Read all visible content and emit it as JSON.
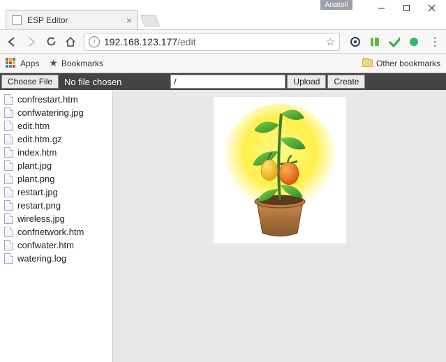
{
  "window": {
    "user_badge": "Anatoli"
  },
  "tab": {
    "title": "ESP Editor"
  },
  "address": {
    "host": "192.168.123.177",
    "path": "/edit"
  },
  "bookmarks": {
    "apps_label": "Apps",
    "bookmarks_label": "Bookmarks",
    "other_label": "Other bookmarks"
  },
  "esp_toolbar": {
    "choose_file": "Choose File",
    "no_file": "No file chosen",
    "path_value": "/",
    "upload": "Upload",
    "create": "Create"
  },
  "files": [
    "confrestart.htm",
    "confwatering.jpg",
    "edit.htm",
    "edit.htm.gz",
    "index.htm",
    "plant.jpg",
    "plant.png",
    "restart.jpg",
    "restart.png",
    "wireless.jpg",
    "confnetwork.htm",
    "confwater.htm",
    "watering.log"
  ]
}
